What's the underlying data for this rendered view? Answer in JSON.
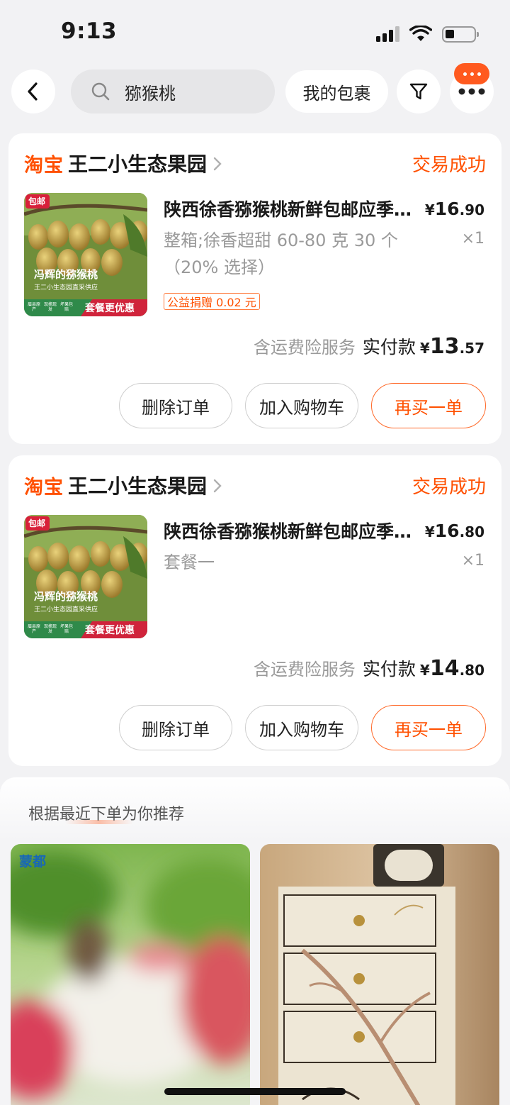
{
  "status_bar": {
    "time": "9:13"
  },
  "nav": {
    "search_query": "猕猴桃",
    "package_button": "我的包裹",
    "icons": [
      "back-icon",
      "search-icon",
      "filter-icon",
      "more-icon"
    ]
  },
  "orders": [
    {
      "logo": "淘宝",
      "shop": "王二小生态果园",
      "status": "交易成功",
      "thumb_badge": "包邮",
      "thumb_caption": "冯辉的猕猴桃",
      "thumb_subcaption": "王二小生态园直采供应",
      "thumb_banner": "套餐更优惠",
      "thumb_tags": [
        "眉县原产",
        "现摘现发",
        "坏果包赔"
      ],
      "title": "陕西徐香猕猴桃新鲜包邮应季水果",
      "price_int": "16",
      "price_dec": ".90",
      "currency": "¥",
      "sku": "整箱;徐香超甜 60-80 克 30 个（20% 选择）",
      "qty": "×1",
      "donation": "公益捐赠 0.02 元",
      "insurance": "含运费险服务",
      "paid_label": "实付款",
      "paid_int": "13",
      "paid_dec": ".57",
      "buttons": [
        "删除订单",
        "加入购物车",
        "再买一单"
      ]
    },
    {
      "logo": "淘宝",
      "shop": "王二小生态果园",
      "status": "交易成功",
      "thumb_badge": "包邮",
      "thumb_caption": "冯辉的猕猴桃",
      "thumb_subcaption": "王二小生态园直采供应",
      "thumb_banner": "套餐更优惠",
      "thumb_tags": [
        "眉县原产",
        "现摘现发",
        "坏果包赔"
      ],
      "title": "陕西徐香猕猴桃新鲜包邮应季水果",
      "price_int": "16",
      "price_dec": ".80",
      "currency": "¥",
      "sku": "套餐一",
      "qty": "×1",
      "insurance": "含运费险服务",
      "paid_label": "实付款",
      "paid_int": "14",
      "paid_dec": ".80",
      "buttons": [
        "删除订单",
        "加入购物车",
        "再买一单"
      ]
    }
  ],
  "recommend": {
    "title": "根据最近下单为你推荐",
    "left_brand": "蒙都"
  },
  "colors": {
    "accent": "#ff5000",
    "page_bg": "#f2f2f4"
  }
}
